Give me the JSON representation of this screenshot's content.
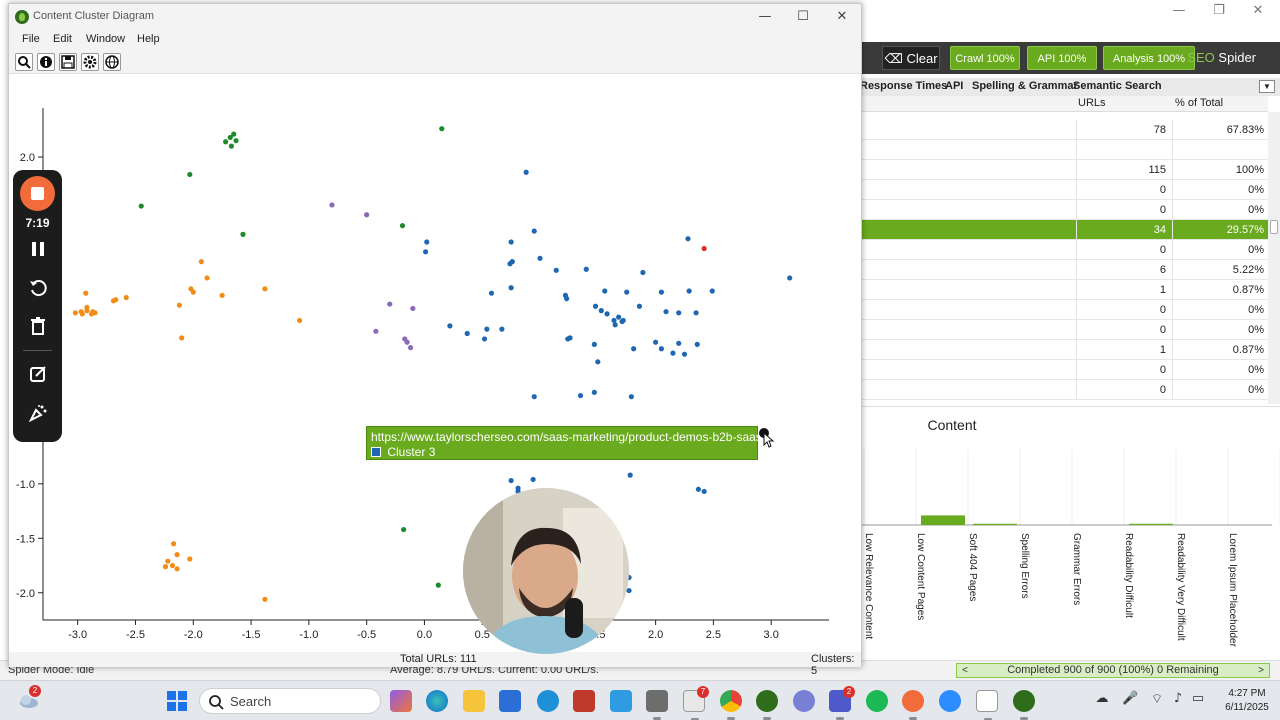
{
  "seo_spider": {
    "toolbar": {
      "clear_label": "Clear",
      "crawl_label": "Crawl 100%",
      "api_label": "API 100%",
      "analysis_label": "Analysis 100%",
      "brand_seo": "SEO",
      "brand_spider": "Spider"
    },
    "tabs": [
      "Response Times",
      "API",
      "Spelling & Grammar",
      "Semantic Search"
    ],
    "table": {
      "columns": [
        "URLs",
        "% of Total"
      ],
      "rows": [
        {
          "urls": "78",
          "pct": "67.83%",
          "selected": false
        },
        {
          "urls": "",
          "pct": "",
          "selected": false
        },
        {
          "urls": "115",
          "pct": "100%",
          "selected": false
        },
        {
          "urls": "0",
          "pct": "0%",
          "selected": false
        },
        {
          "urls": "0",
          "pct": "0%",
          "selected": false
        },
        {
          "urls": "34",
          "pct": "29.57%",
          "selected": true
        },
        {
          "urls": "0",
          "pct": "0%",
          "selected": false
        },
        {
          "urls": "6",
          "pct": "5.22%",
          "selected": false
        },
        {
          "urls": "1",
          "pct": "0.87%",
          "selected": false
        },
        {
          "urls": "0",
          "pct": "0%",
          "selected": false
        },
        {
          "urls": "0",
          "pct": "0%",
          "selected": false
        },
        {
          "urls": "1",
          "pct": "0.87%",
          "selected": false
        },
        {
          "urls": "0",
          "pct": "0%",
          "selected": false
        },
        {
          "urls": "0",
          "pct": "0%",
          "selected": false
        }
      ]
    },
    "content_panel": {
      "title": "Content",
      "categories": [
        "Low Relevance Content",
        "Low Content Pages",
        "Soft 404 Pages",
        "Spelling Errors",
        "Grammar Errors",
        "Readability Difficult",
        "Readability Very Difficult",
        "Lorem Ipsum Placeholder"
      ]
    },
    "status": {
      "spider_mode": "Spider Mode: Idle",
      "average": "Average: 8.79 URL/s. Current: 0.00 URL/s.",
      "progress": "Completed 900 of 900 (100%) 0 Remaining"
    }
  },
  "cluster_window": {
    "title": "Content Cluster Diagram",
    "menu": [
      "File",
      "Edit",
      "Window",
      "Help"
    ],
    "toolbar_icons": [
      "search-icon",
      "info-icon",
      "save-icon",
      "gear-icon",
      "globe-icon"
    ],
    "footer": {
      "total_urls": "Total URLs: 111",
      "clusters": "Clusters: 5"
    },
    "tooltip": {
      "url": "https://www.taylorscherseo.com/saas-marketing/product-demos-b2b-saas/",
      "cluster": "Cluster 3"
    }
  },
  "recorder": {
    "time": "7:19"
  },
  "taskbar": {
    "search_placeholder": "Search",
    "weather_badge": "2",
    "badges": {
      "app7": "7",
      "teams": "2"
    },
    "clock_time": "4:27 PM",
    "clock_date": "6/11/2025"
  },
  "colors": {
    "seo_green": "#6aaa1e",
    "cluster_blue": "#1f66b3",
    "cluster_green": "#1e8a2e",
    "cluster_orange": "#f28c18",
    "cluster_purple": "#8a6ab8",
    "cluster_red": "#d9302c"
  },
  "chart_data": {
    "type": "scatter",
    "xlim": [
      -3.3,
      3.5
    ],
    "ylim": [
      -2.25,
      2.45
    ],
    "xticks": [
      "-3.0",
      "-2.5",
      "-2.0",
      "-1.5",
      "-1.0",
      "-0.5",
      "0.0",
      "0.5",
      "1.0",
      "1.5",
      "2.0",
      "2.5",
      "3.0"
    ],
    "yticks": [
      "2.0",
      "-1.0",
      "-1.5",
      "-2.0"
    ],
    "series": [
      {
        "color": "#1e8a2e",
        "points": [
          [
            -1.65,
            2.21
          ],
          [
            -1.68,
            2.18
          ],
          [
            -1.63,
            2.15
          ],
          [
            -1.72,
            2.14
          ],
          [
            -1.67,
            2.1
          ],
          [
            0.15,
            2.26
          ],
          [
            -2.03,
            1.84
          ],
          [
            -2.45,
            1.55
          ],
          [
            -1.57,
            1.29
          ],
          [
            -0.19,
            1.37
          ],
          [
            -0.18,
            -1.42
          ],
          [
            0.12,
            -1.93
          ]
        ]
      },
      {
        "color": "#1f66b3",
        "points": [
          [
            0.88,
            1.86
          ],
          [
            0.95,
            1.32
          ],
          [
            0.02,
            1.22
          ],
          [
            0.01,
            1.13
          ],
          [
            1.0,
            1.07
          ],
          [
            0.75,
            1.22
          ],
          [
            0.76,
            1.04
          ],
          [
            0.74,
            1.02
          ],
          [
            1.14,
            0.96
          ],
          [
            1.4,
            0.97
          ],
          [
            1.89,
            0.94
          ],
          [
            2.28,
            1.25
          ],
          [
            3.16,
            0.89
          ],
          [
            1.56,
            0.77
          ],
          [
            1.75,
            0.76
          ],
          [
            2.05,
            0.76
          ],
          [
            2.29,
            0.77
          ],
          [
            2.49,
            0.77
          ],
          [
            1.22,
            0.73
          ],
          [
            1.23,
            0.7
          ],
          [
            0.58,
            0.75
          ],
          [
            0.75,
            0.8
          ],
          [
            1.48,
            0.63
          ],
          [
            1.86,
            0.63
          ],
          [
            2.09,
            0.58
          ],
          [
            1.53,
            0.59
          ],
          [
            1.58,
            0.56
          ],
          [
            1.64,
            0.5
          ],
          [
            1.72,
            0.5
          ],
          [
            1.68,
            0.53
          ],
          [
            1.71,
            0.49
          ],
          [
            1.65,
            0.46
          ],
          [
            2.2,
            0.57
          ],
          [
            2.35,
            0.57
          ],
          [
            0.22,
            0.45
          ],
          [
            0.54,
            0.42
          ],
          [
            0.67,
            0.42
          ],
          [
            0.52,
            0.33
          ],
          [
            1.24,
            0.33
          ],
          [
            1.26,
            0.34
          ],
          [
            2.0,
            0.3
          ],
          [
            2.2,
            0.29
          ],
          [
            2.36,
            0.28
          ],
          [
            1.81,
            0.24
          ],
          [
            2.05,
            0.24
          ],
          [
            2.15,
            0.2
          ],
          [
            2.25,
            0.19
          ],
          [
            1.47,
            0.28
          ],
          [
            1.5,
            0.12
          ],
          [
            0.37,
            0.38
          ],
          [
            0.95,
            -0.2
          ],
          [
            1.35,
            -0.19
          ],
          [
            1.47,
            -0.16
          ],
          [
            1.79,
            -0.2
          ],
          [
            0.75,
            -0.97
          ],
          [
            0.94,
            -0.96
          ],
          [
            0.81,
            -1.07
          ],
          [
            0.81,
            -1.04
          ],
          [
            1.78,
            -0.92
          ],
          [
            2.37,
            -1.05
          ],
          [
            2.42,
            -1.07
          ],
          [
            1.77,
            -1.86
          ],
          [
            1.77,
            -1.98
          ]
        ]
      },
      {
        "color": "#f28c18",
        "points": [
          [
            -1.93,
            1.04
          ],
          [
            -1.88,
            0.89
          ],
          [
            -2.02,
            0.79
          ],
          [
            -2.0,
            0.76
          ],
          [
            -1.75,
            0.73
          ],
          [
            -2.12,
            0.64
          ],
          [
            -2.93,
            0.75
          ],
          [
            -2.67,
            0.69
          ],
          [
            -2.69,
            0.68
          ],
          [
            -2.58,
            0.71
          ],
          [
            -2.92,
            0.62
          ],
          [
            -2.97,
            0.58
          ],
          [
            -2.92,
            0.59
          ],
          [
            -2.87,
            0.58
          ],
          [
            -3.02,
            0.57
          ],
          [
            -2.96,
            0.56
          ],
          [
            -2.88,
            0.56
          ],
          [
            -2.85,
            0.57
          ],
          [
            -1.38,
            0.79
          ],
          [
            -1.08,
            0.5
          ],
          [
            -2.1,
            0.34
          ],
          [
            -2.17,
            -1.55
          ],
          [
            -2.14,
            -1.65
          ],
          [
            -2.22,
            -1.71
          ],
          [
            -2.18,
            -1.75
          ],
          [
            -2.24,
            -1.76
          ],
          [
            -2.14,
            -1.78
          ],
          [
            -2.03,
            -1.69
          ],
          [
            -1.38,
            -2.06
          ]
        ]
      },
      {
        "color": "#8a6ab8",
        "points": [
          [
            -0.8,
            1.56
          ],
          [
            -0.5,
            1.47
          ],
          [
            -0.3,
            0.65
          ],
          [
            -0.1,
            0.61
          ],
          [
            -0.42,
            0.4
          ],
          [
            -0.17,
            0.33
          ],
          [
            -0.15,
            0.3
          ],
          [
            -0.12,
            0.25
          ]
        ]
      },
      {
        "color": "#d9302c",
        "points": [
          [
            2.42,
            1.16
          ]
        ]
      }
    ]
  }
}
